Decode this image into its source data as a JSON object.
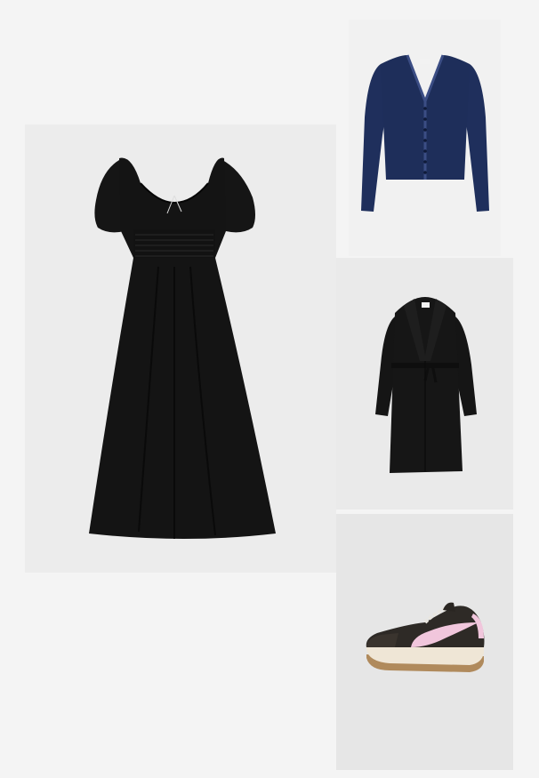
{
  "products": [
    {
      "id": "dress",
      "icon": "black-puff-sleeve-midi-dress",
      "colors": {
        "fabric": "#141414",
        "shadow": "#0a0a0a"
      }
    },
    {
      "id": "cardigan",
      "icon": "navy-lace-trim-cardigan",
      "colors": {
        "fabric": "#1e2f5c",
        "trim": "#2b3e70"
      }
    },
    {
      "id": "coat",
      "icon": "black-belted-coat",
      "colors": {
        "fabric": "#161616",
        "lining": "#2a2a2a"
      }
    },
    {
      "id": "sneaker",
      "icon": "black-pink-retro-sneaker",
      "colors": {
        "upper": "#2e2a26",
        "swoosh": "#f1c6dc",
        "sole": "#efe6d6",
        "outsole": "#b08a5c"
      }
    }
  ],
  "background": "#f4f4f4"
}
